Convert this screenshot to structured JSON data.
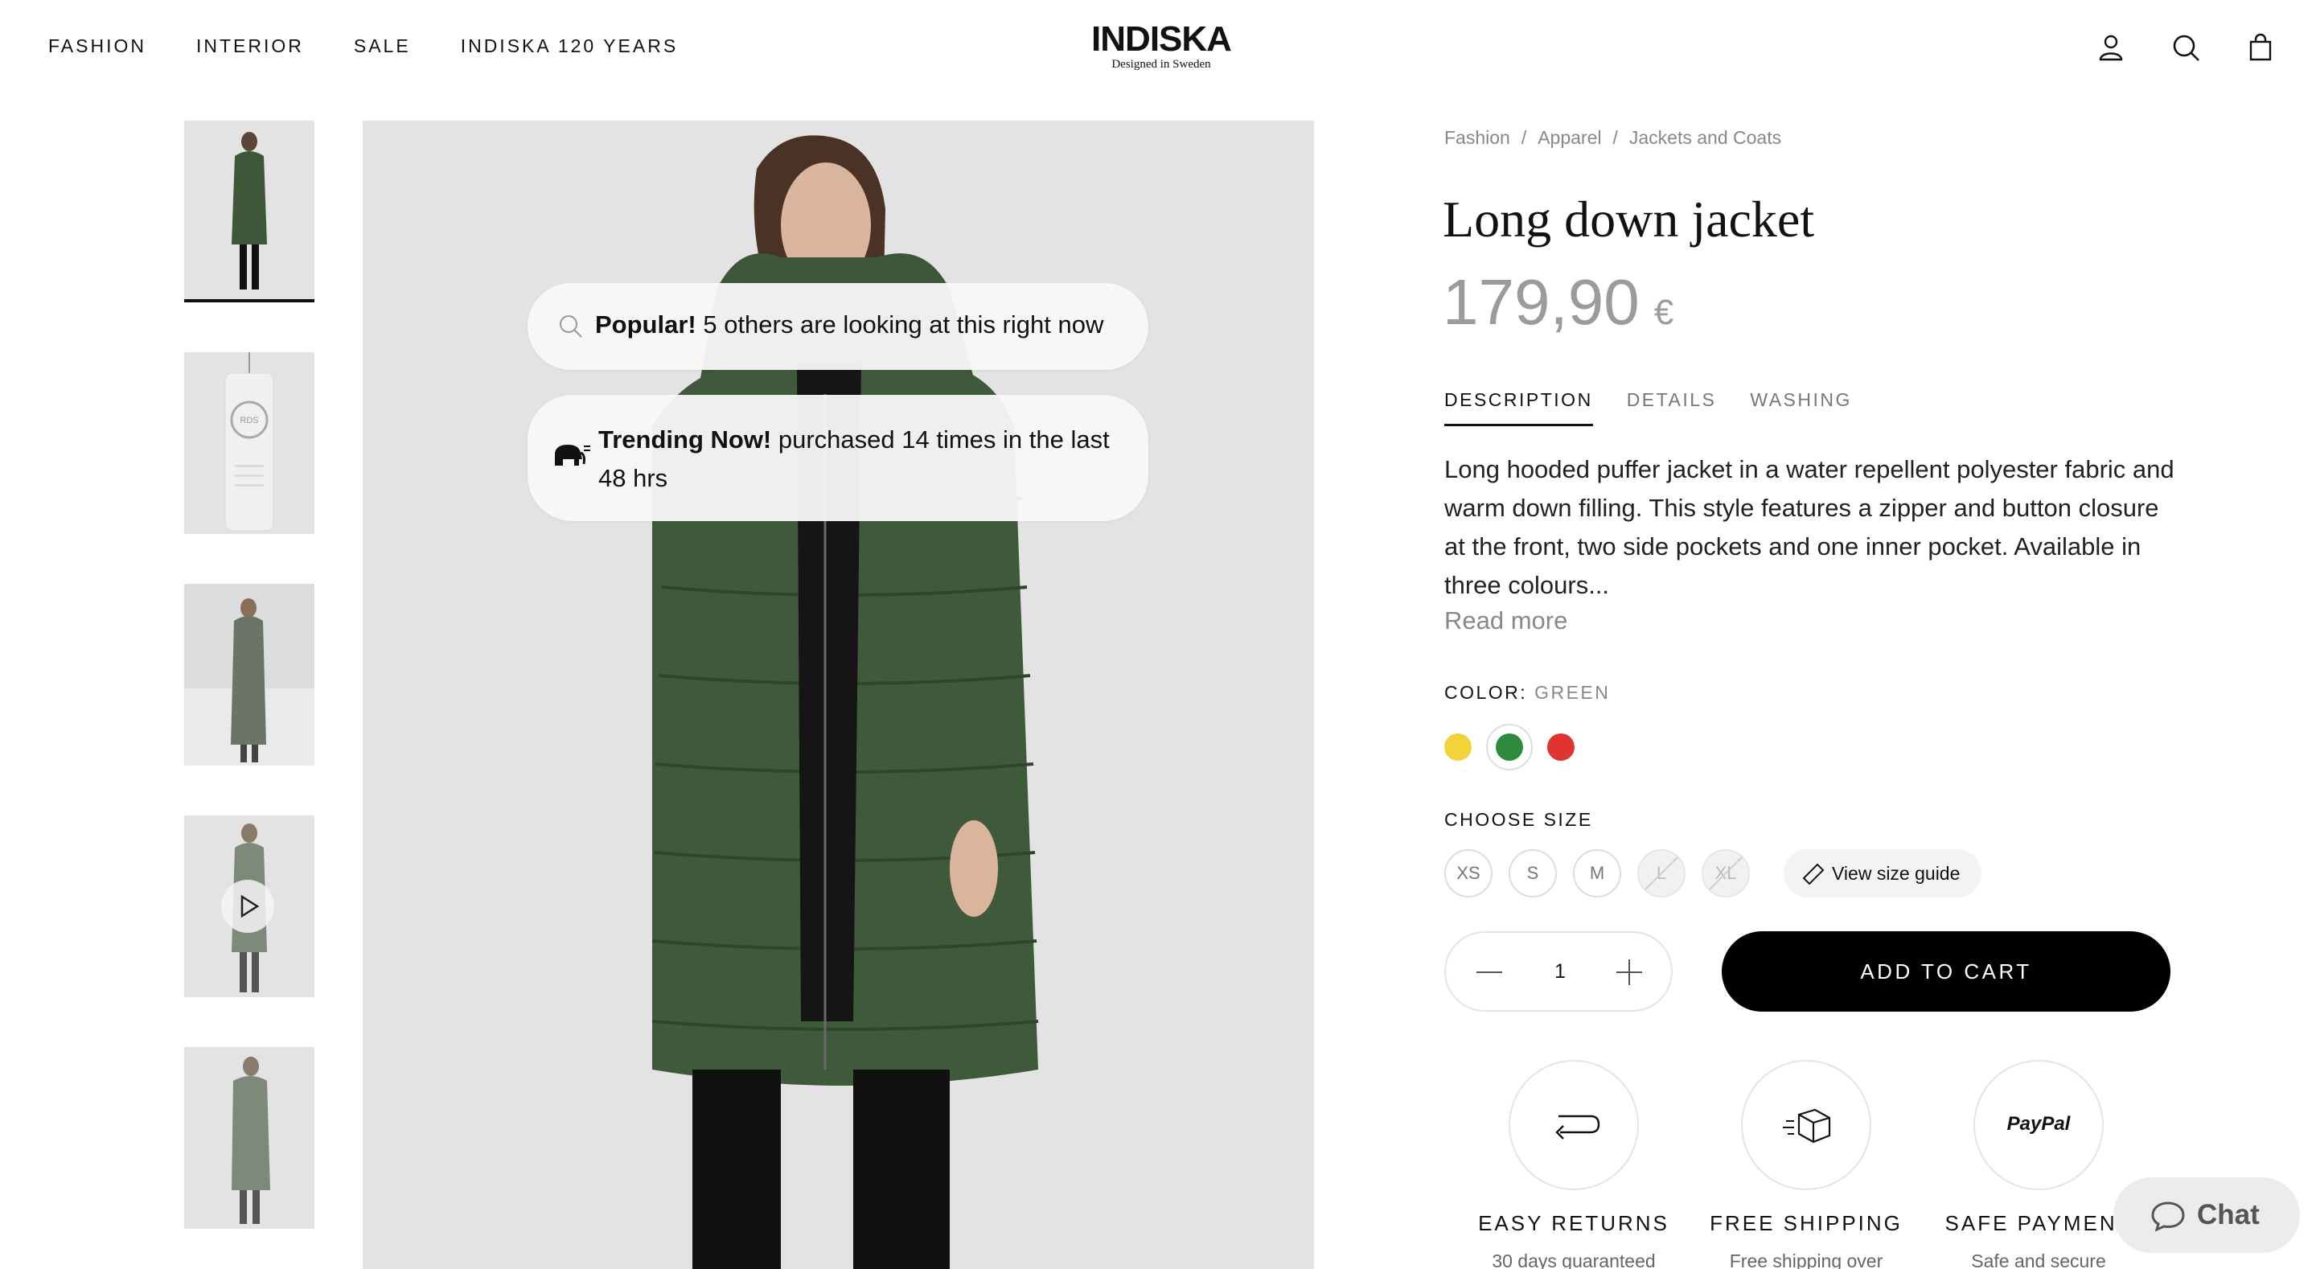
{
  "header": {
    "nav": [
      "FASHION",
      "INTERIOR",
      "SALE",
      "INDISKA 120 YEARS"
    ],
    "logo_brand": "INDISKA",
    "logo_tagline": "Designed in Sweden",
    "icons": [
      "account-icon",
      "search-icon",
      "bag-icon"
    ]
  },
  "gallery": {
    "thumbnails": [
      "model-front",
      "rds-label",
      "model-outdoor",
      "video",
      "model-side",
      "model-partial"
    ],
    "active_index": 0
  },
  "badges": {
    "popular_bold": "Popular!",
    "popular_text": " 5 others are looking at this right now",
    "trending_bold": "Trending Now!",
    "trending_text": " purchased 14 times in the last 48 hrs"
  },
  "product": {
    "breadcrumbs": [
      "Fashion",
      "Apparel",
      "Jackets and Coats"
    ],
    "title": "Long down jacket",
    "price": "179,90",
    "currency": "€",
    "tabs": [
      "DESCRIPTION",
      "DETAILS",
      "WASHING"
    ],
    "active_tab": "DESCRIPTION",
    "description": "Long hooded puffer jacket in a water repellent polyester fabric and warm down filling. This style features a zipper and button closure at the front, two side pockets and one inner pocket. Available in three colours...",
    "read_more": "Read more",
    "color_label": "COLOR:",
    "color_value": "GREEN",
    "colors": [
      {
        "name": "yellow",
        "hex": "#f2d43a"
      },
      {
        "name": "green",
        "hex": "#2e8b3e",
        "selected": true
      },
      {
        "name": "red",
        "hex": "#e03431"
      }
    ],
    "size_label": "CHOOSE SIZE",
    "sizes": [
      {
        "label": "XS",
        "available": true
      },
      {
        "label": "S",
        "available": true
      },
      {
        "label": "M",
        "available": true
      },
      {
        "label": "L",
        "available": false
      },
      {
        "label": "XL",
        "available": false
      }
    ],
    "size_guide": "View size guide",
    "quantity": "1",
    "add_to_cart": "ADD TO CART"
  },
  "usps": [
    {
      "title": "EASY RETURNS",
      "sub": "30 days guaranteed",
      "icon": "return-arrow-icon"
    },
    {
      "title": "FREE SHIPPING",
      "sub": "Free shipping over",
      "icon": "package-icon"
    },
    {
      "title": "SAFE PAYMENT",
      "sub": "Safe and secure",
      "icon": "paypal-icon",
      "icon_text": "PayPal"
    }
  ],
  "chat": {
    "label": "Chat"
  },
  "colors": {
    "accent": "#000000",
    "muted": "#888888",
    "jacket": "#3f5a3a"
  }
}
